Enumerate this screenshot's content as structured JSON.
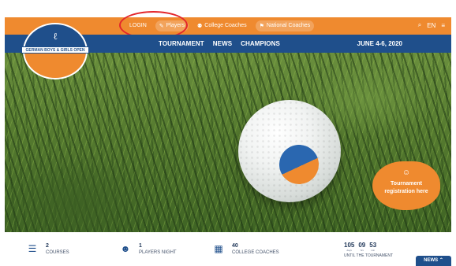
{
  "topbar": {
    "login": "LOGIN",
    "players": "Players",
    "college_coaches": "College Coaches",
    "national_coaches": "National Coaches",
    "language": "EN",
    "icons": {
      "players": "person-icon",
      "college": "group-icon",
      "national": "flag-icon",
      "search": "search-icon",
      "menu": "menu-icon"
    }
  },
  "nav": {
    "items": [
      "TOURNAMENT",
      "NEWS",
      "CHAMPIONS"
    ],
    "date": "JUNE 4-6, 2020"
  },
  "logo": {
    "ribbon_text": "GERMAN BOYS & GIRLS OPEN"
  },
  "hero": {
    "registration_label": "Tournament registration here",
    "icons": {
      "registration": "user-add-icon"
    }
  },
  "stats": [
    {
      "value": "2",
      "label": "COURSES",
      "icon": "course-icon"
    },
    {
      "value": "1",
      "label": "PLAYERS NIGHT",
      "icon": "smiley-icon"
    },
    {
      "value": "40",
      "label": "COLLEGE COACHES",
      "icon": "map-icon"
    }
  ],
  "countdown": {
    "days": "105",
    "hours": "09",
    "minutes": "53",
    "units": [
      "days",
      "hrs",
      "min"
    ],
    "label": "UNTIL THE TOURNAMENT"
  },
  "news_button": {
    "label": "NEWS",
    "icon": "chevron-up-icon"
  },
  "colors": {
    "orange": "#ef8a2f",
    "blue": "#1f4f8b",
    "annotation": "#e3262b"
  }
}
